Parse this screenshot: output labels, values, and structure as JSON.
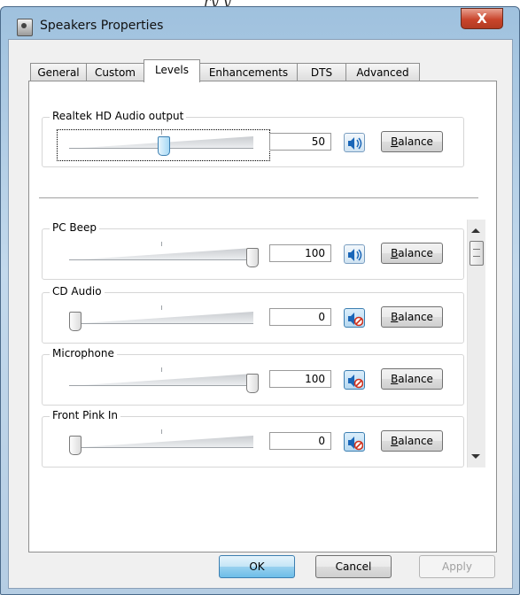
{
  "caption": "ry   y",
  "window": {
    "title": "Speakers Properties",
    "close_label": "X"
  },
  "tabs": [
    {
      "label": "General",
      "active": false
    },
    {
      "label": "Custom",
      "active": false
    },
    {
      "label": "Levels",
      "active": true
    },
    {
      "label": "Enhancements",
      "active": false
    },
    {
      "label": "DTS",
      "active": false
    },
    {
      "label": "Advanced",
      "active": false
    }
  ],
  "master": {
    "label": "Realtek HD Audio output",
    "value": "50",
    "level_percent": 50,
    "muted": false,
    "balance_label": "Balance",
    "balance_accel": "B",
    "balance_rest": "alance"
  },
  "devices": [
    {
      "label": "PC Beep",
      "value": "100",
      "level_percent": 100,
      "muted": false,
      "balance_accel": "B",
      "balance_rest": "alance"
    },
    {
      "label": "CD Audio",
      "value": "0",
      "level_percent": 0,
      "muted": true,
      "balance_accel": "B",
      "balance_rest": "alance"
    },
    {
      "label": "Microphone",
      "value": "100",
      "level_percent": 100,
      "muted": true,
      "balance_accel": "B",
      "balance_rest": "alance"
    },
    {
      "label": "Front Pink In",
      "value": "0",
      "level_percent": 0,
      "muted": true,
      "balance_accel": "B",
      "balance_rest": "alance"
    }
  ],
  "buttons": {
    "ok": "OK",
    "cancel": "Cancel",
    "apply": "Apply"
  },
  "colors": {
    "accent": "#3c7fb1",
    "mute_red": "#d0301c",
    "speaker_blue": "#1a66b8"
  }
}
